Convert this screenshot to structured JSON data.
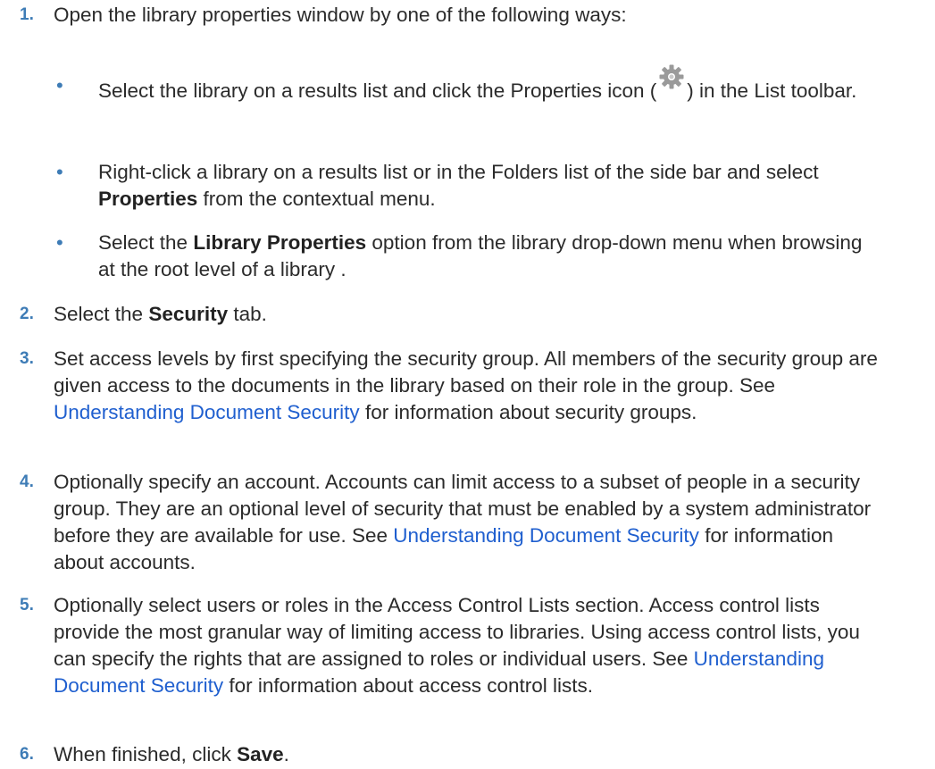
{
  "steps": [
    {
      "num": "1.",
      "text": "Open the library properties window by one of the following ways:",
      "bullets": [
        {
          "a": "Select the library on a results list and click the Properties icon (",
          "icon": "gear-icon",
          "b": ") in the List toolbar."
        },
        {
          "a": "Right-click a library on a results list or in the Folders list of the side bar and select ",
          "bold": "Properties",
          "b": " from the contextual menu."
        },
        {
          "a": "Select the ",
          "bold": "Library Properties",
          "b": " option from the library drop-down menu when browsing at the root level of a library ."
        }
      ]
    },
    {
      "num": "2.",
      "a": "Select the ",
      "bold": "Security",
      "b": " tab."
    },
    {
      "num": "3.",
      "a": "Set access levels by first specifying the security group. All members of the security group are given access to the documents in the library based on their role in the group. See ",
      "link": "Understanding Document Security",
      "b": " for information about security groups."
    },
    {
      "num": "4.",
      "a": "Optionally specify an account. Accounts can limit access to a subset of people in a security group. They are an optional level of security that must be enabled by a system administrator before they are available for use. See ",
      "link": "Understanding Document Security",
      "b": " for information about accounts."
    },
    {
      "num": "5.",
      "a": "Optionally select users or roles in the Access Control Lists section. Access control lists provide the most granular way of limiting access to libraries. Using access control lists, you can specify the rights that are assigned to roles or individual users. See ",
      "link": "Understanding Document Security",
      "b": " for information about access control lists."
    },
    {
      "num": "6.",
      "a": "When finished, click ",
      "bold": "Save",
      "b": "."
    }
  ],
  "colors": {
    "step_number": "#3e7cb6",
    "link": "#1f5fcf",
    "text": "#2b2b2b",
    "icon": "#9a9a9a"
  }
}
